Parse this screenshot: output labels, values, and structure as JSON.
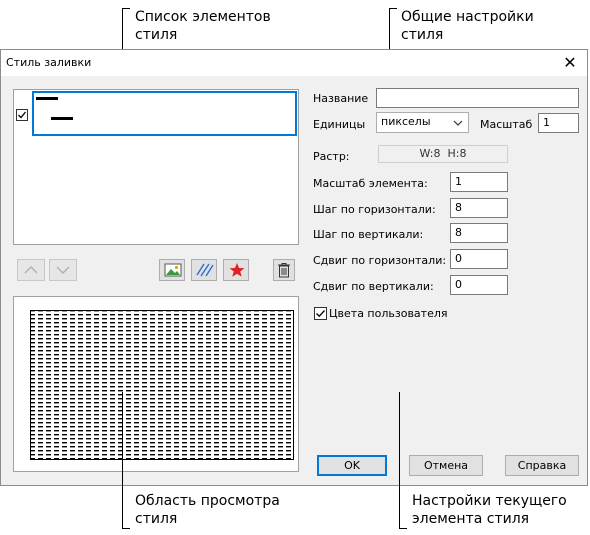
{
  "callouts": {
    "elements_list": [
      "Список элементов",
      "стиля"
    ],
    "general_settings": [
      "Общие настройки",
      "стиля"
    ],
    "preview_area": [
      "Область просмотра",
      "стиля"
    ],
    "current_element_settings": [
      "Настройки текущего",
      "элемента стиля"
    ]
  },
  "dialog": {
    "title": "Стиль заливки",
    "close_icon": "close-icon",
    "checkbox_checked": true
  },
  "form": {
    "name_label": "Название",
    "name_value": "",
    "units_label": "Единицы",
    "units_value": "пикселы",
    "scale_label": "Масштаб",
    "scale_value": "1",
    "raster_label": "Растр:",
    "raster_value": "W:8  H:8",
    "element_scale_label": "Масштаб элемента:",
    "element_scale_value": "1",
    "h_step_label": "Шаг по горизонтали:",
    "h_step_value": "8",
    "v_step_label": "Шаг по вертикали:",
    "v_step_value": "8",
    "h_shift_label": "Сдвиг по горизонтали:",
    "h_shift_value": "0",
    "v_shift_label": "Сдвиг по вертикали:",
    "v_shift_value": "0",
    "user_colors_label": "Цвета пользователя",
    "user_colors_checked": true
  },
  "buttons": {
    "ok": "OK",
    "cancel": "Отмена",
    "help": "Справка"
  },
  "icons": [
    "chevron-up-icon",
    "chevron-down-icon",
    "image-icon",
    "hatch-icon",
    "star-icon",
    "trash-icon"
  ],
  "colors": {
    "accent": "#0078d7",
    "star": "#e02020"
  }
}
